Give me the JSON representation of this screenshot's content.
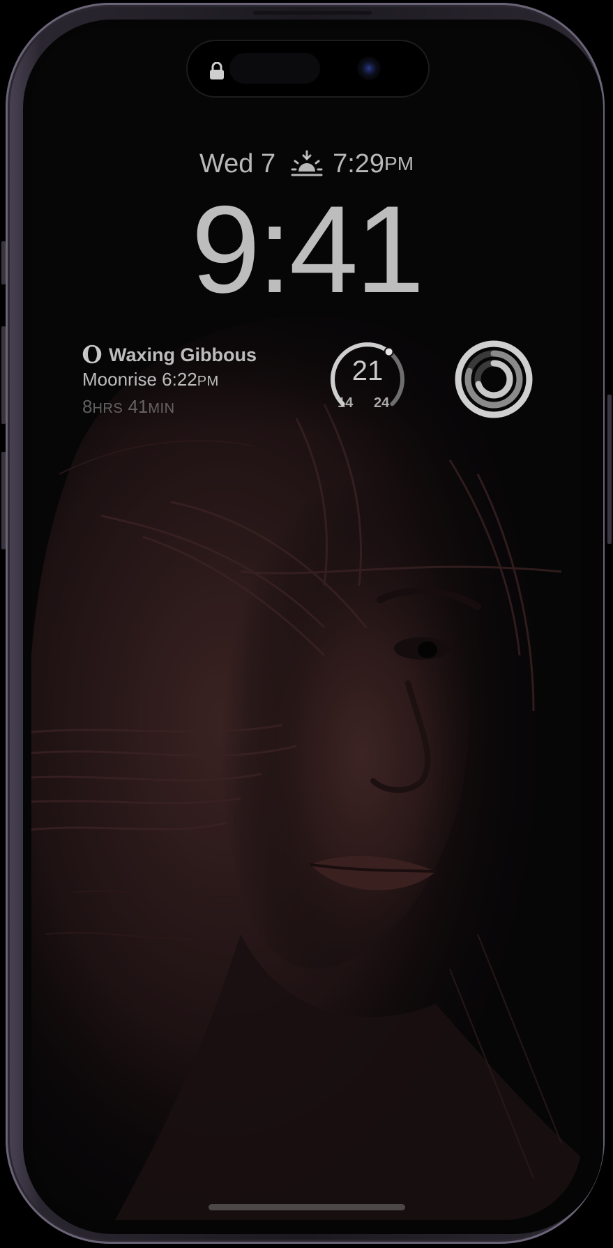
{
  "status": {
    "date": "Wed 7",
    "sunset_time": "7:29",
    "sunset_ampm": "PM",
    "sunset_icon": "sunset-icon",
    "lock_icon": "lock-icon"
  },
  "clock": {
    "time": "9:41"
  },
  "moon_widget": {
    "icon": "moon-phase-icon",
    "title": "Waxing Gibbous",
    "moonrise_label": "Moonrise 6:22",
    "moonrise_ampm": "PM",
    "duration_hours": "8",
    "duration_hours_unit": "HRS",
    "duration_minutes": "41",
    "duration_minutes_unit": "MIN"
  },
  "weather_widget": {
    "current": "21",
    "low": "14",
    "high": "24",
    "gauge_fraction": 0.64
  },
  "activity_widget": {
    "icon": "activity-rings-icon",
    "move_fraction": 1.0,
    "exercise_fraction": 0.8,
    "stand_fraction": 0.7
  },
  "colors": {
    "frame": "#2a2630",
    "frame_highlight": "#6b6377",
    "text": "#d6d6d6",
    "gauge_track": "#6e6e6e",
    "gauge_fill": "#cfcfcf"
  }
}
